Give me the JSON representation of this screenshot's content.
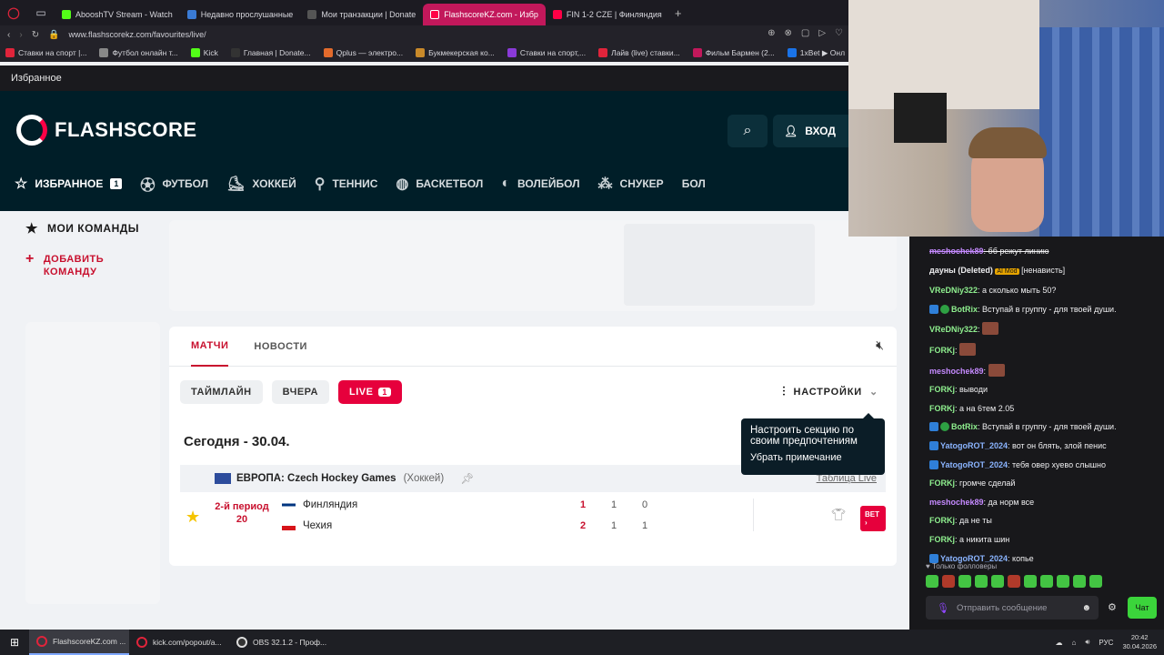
{
  "browser": {
    "tabs": [
      {
        "label": "AbooshTV Stream - Watch",
        "color": "#53fc18"
      },
      {
        "label": "Недавно прослушанные",
        "color": "#3a7bd5"
      },
      {
        "label": "Мои транзакции | Donate",
        "color": "#222222"
      },
      {
        "label": "FlashscoreKZ.com - Избр",
        "color": "#ff0046"
      },
      {
        "label": "FIN 1-2 CZE | Финляндия",
        "color": "#c2185b"
      }
    ],
    "url": "www.flashscorekz.com/favourites/live/",
    "bookmarks": [
      "Ставки на спорт |...",
      "Футбол онлайн т...",
      "Kick",
      "Главная | Donate...",
      "Qplus — электро...",
      "Букмекерская ко...",
      "Ставки на спорт,...",
      "Лайв (live) ставки...",
      "Фильм Бармен (2...",
      "1xBet ▶ Онл"
    ],
    "page_heading": "Избранное"
  },
  "header": {
    "logo": "FLASHSCORE",
    "login": "ВХОД",
    "nav": [
      {
        "label": "ИЗБРАННОЕ",
        "icon": "star-icon",
        "badge": "1"
      },
      {
        "label": "ФУТБОЛ",
        "icon": "football-icon"
      },
      {
        "label": "ХОККЕЙ",
        "icon": "hockey-icon"
      },
      {
        "label": "ТЕННИС",
        "icon": "tennis-icon"
      },
      {
        "label": "БАСКЕТБОЛ",
        "icon": "basketball-icon"
      },
      {
        "label": "ВОЛЕЙБОЛ",
        "icon": "volleyball-icon"
      },
      {
        "label": "СНУКЕР",
        "icon": "snooker-icon"
      },
      {
        "label": "БОЛ",
        "icon": ""
      }
    ]
  },
  "left_menu": {
    "my_teams": "МОИ КОМАНДЫ",
    "add_team": "ДОБАВИТЬ КОМАНДУ"
  },
  "main": {
    "tabs": [
      "МАТЧИ",
      "НОВОСТИ"
    ],
    "filters": {
      "timeline": "ТАЙМЛАЙН",
      "yesterday": "ВЧЕРА",
      "live": "LIVE",
      "live_count": "1"
    },
    "settings": "НАСТРОЙКИ",
    "date_title": "Сегодня - 30.04.",
    "league": {
      "name": "ЕВРОПА: Czech Hockey Games",
      "sport": "(Хоккей)",
      "table": "Таблица Live"
    },
    "match": {
      "period": "2-й период",
      "minute": "20",
      "home": "Финляндия",
      "away": "Чехия",
      "home_score": "1",
      "away_score": "2",
      "home_p1": "1",
      "home_p2": "0",
      "away_p1": "1",
      "away_p2": "1",
      "bet": "BET ›"
    },
    "tooltip": {
      "message": "Настроить секцию по своим предпочтениям",
      "dismiss": "Убрать примечание"
    }
  },
  "chat": {
    "messages": [
      {
        "user": "meshochek89",
        "text": ": бб режут линию",
        "color": "#c58aff",
        "strike": true
      },
      {
        "user": "дауны (Deleted)",
        "text": " [ненависть]",
        "color": "#efeff1",
        "mod": "AI Mod"
      },
      {
        "user": "VReDNiy322",
        "text": ": а сколько мыть 50?",
        "color": "#8ff08f"
      },
      {
        "user": "BotRix",
        "text": ": Вступай в группу - для твоей души.",
        "color": "#8ff08f",
        "badges": true
      },
      {
        "user": "VReDNiy322",
        "text": ":",
        "color": "#8ff08f",
        "emote": true
      },
      {
        "user": "FORKj",
        "text": ":",
        "color": "#8ff08f",
        "emote": true
      },
      {
        "user": "meshochek89",
        "text": ":",
        "color": "#c58aff",
        "emote": true
      },
      {
        "user": "FORKj",
        "text": ": выводи",
        "color": "#8ff08f"
      },
      {
        "user": "FORKj",
        "text": ": а на 6тем 2.05",
        "color": "#8ff08f"
      },
      {
        "user": "BotRix",
        "text": ": Вступай в группу - для твоей души.",
        "color": "#8ff08f",
        "badges": true
      },
      {
        "user": "YatogoROT_2024",
        "text": ": вот он блять, злой пенис",
        "color": "#8ab4ff",
        "badge1": true
      },
      {
        "user": "YatogoROT_2024",
        "text": ": тебя овер хуево слышно",
        "color": "#8ab4ff",
        "badge1": true
      },
      {
        "user": "FORKj",
        "text": ": громче сделай",
        "color": "#8ff08f"
      },
      {
        "user": "meshochek89",
        "text": ": да норм все",
        "color": "#c58aff"
      },
      {
        "user": "FORKj",
        "text": ": да не ты",
        "color": "#8ff08f"
      },
      {
        "user": "FORKj",
        "text": ": а никита шин",
        "color": "#8ff08f"
      },
      {
        "user": "YatogoROT_2024",
        "text": ": копье",
        "color": "#8ab4ff",
        "badge1": true
      }
    ],
    "followers_only": "♥ Только фолловеры",
    "input_placeholder": "Отправить сообщение",
    "send": "Чат"
  },
  "taskbar": {
    "items": [
      "FlashscoreKZ.com ...",
      "kick.com/popout/a...",
      "OBS 32.1.2 - Проф..."
    ],
    "lang": "РУС",
    "time": "20:42",
    "date": "30.04.2026"
  }
}
